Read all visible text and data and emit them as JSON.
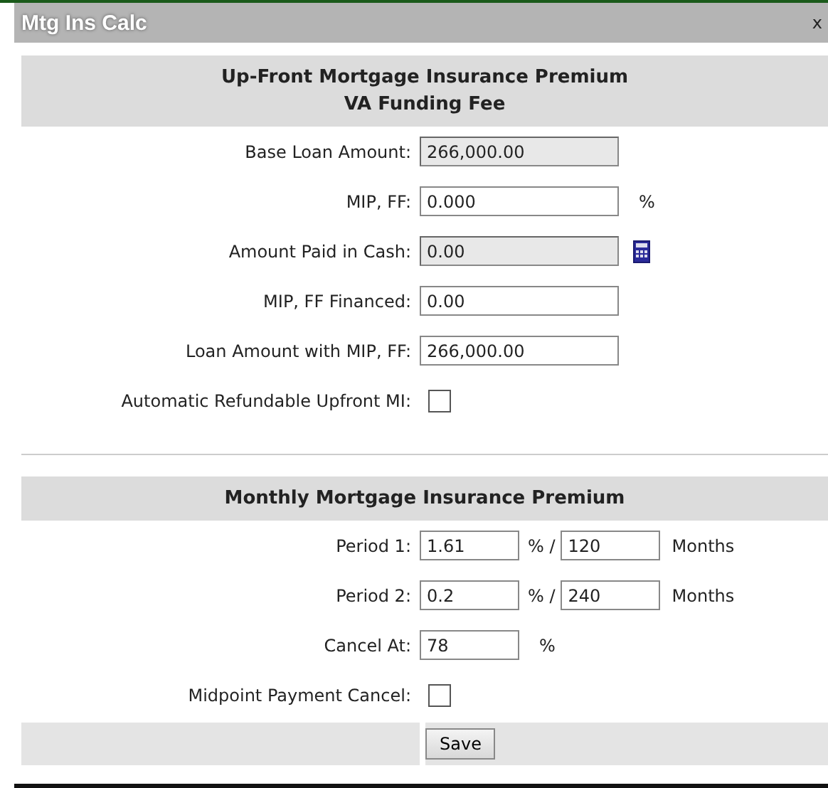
{
  "window": {
    "title": "Mtg Ins Calc",
    "close": "x"
  },
  "upfront": {
    "heading": [
      "Up-Front Mortgage Insurance Premium",
      "VA Funding Fee"
    ],
    "rows": [
      {
        "kind": "field",
        "label": "Base Loan Amount:",
        "value": "266,000.00",
        "readonly": true
      },
      {
        "kind": "field",
        "label": "MIP, FF:",
        "value": "0.000",
        "readonly": false,
        "suffix": "%"
      },
      {
        "kind": "field",
        "label": "Amount Paid in Cash:",
        "value": "0.00",
        "readonly": true,
        "calculator": true
      },
      {
        "kind": "field",
        "label": "MIP, FF Financed:",
        "value": "0.00",
        "readonly": false
      },
      {
        "kind": "field",
        "label": "Loan Amount with MIP, FF:",
        "value": "266,000.00",
        "readonly": false
      },
      {
        "kind": "checkbox",
        "label": "Automatic Refundable Upfront MI:",
        "checked": false
      }
    ]
  },
  "monthly": {
    "heading": [
      "Monthly Mortgage Insurance Premium"
    ],
    "rows": [
      {
        "kind": "period",
        "label": "Period 1:",
        "rate": "1.61",
        "separator": "% /",
        "months": "120",
        "unit": "Months"
      },
      {
        "kind": "period",
        "label": "Period 2:",
        "rate": "0.2",
        "separator": "% /",
        "months": "240",
        "unit": "Months"
      },
      {
        "kind": "short",
        "label": "Cancel At:",
        "value": "78",
        "suffix": "%"
      },
      {
        "kind": "checkbox",
        "label": "Midpoint Payment Cancel:",
        "checked": false
      }
    ]
  },
  "save_button": "Save"
}
